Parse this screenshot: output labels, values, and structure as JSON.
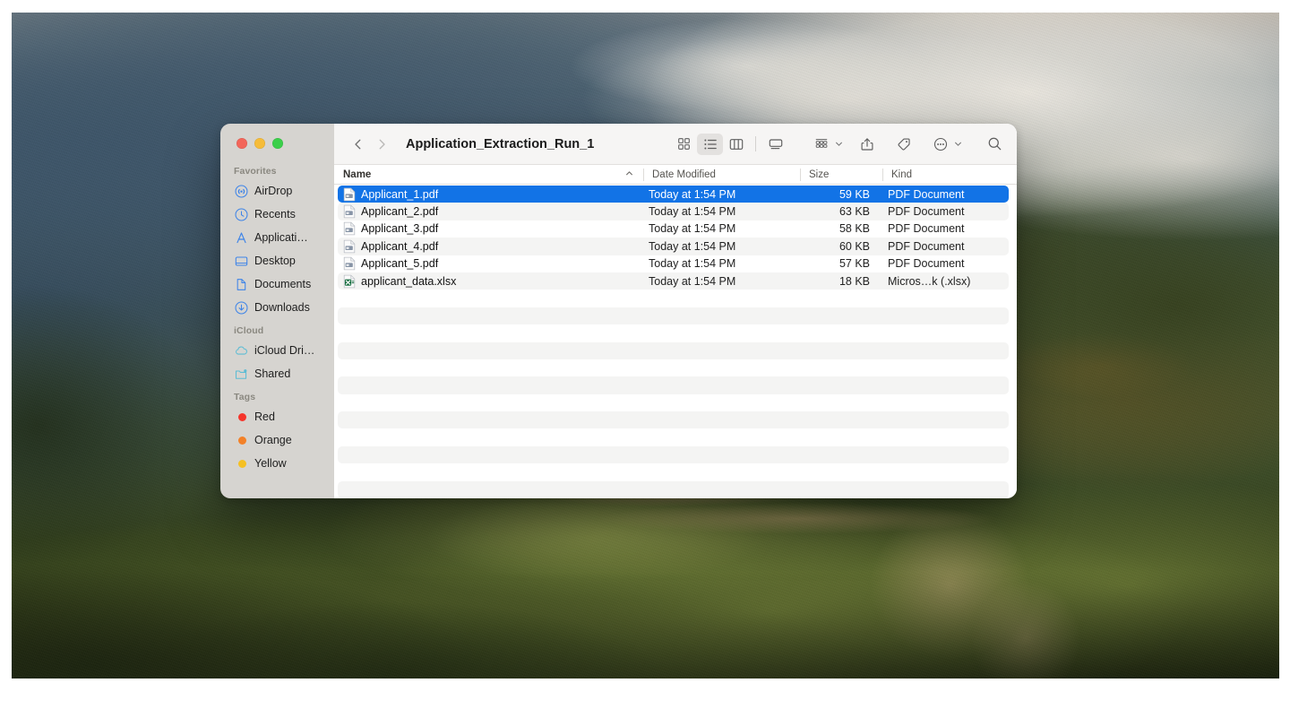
{
  "window": {
    "title": "Application_Extraction_Run_1",
    "traffic_lights": [
      "close",
      "minimize",
      "zoom"
    ]
  },
  "nav": {
    "back_icon": "chevron-left-icon",
    "forward_icon": "chevron-right-icon"
  },
  "toolbar": {
    "views": [
      {
        "name": "icon-view",
        "icon": "grid-icon",
        "active": false
      },
      {
        "name": "list-view",
        "icon": "list-icon",
        "active": true
      },
      {
        "name": "column-view",
        "icon": "columns-icon",
        "active": false
      },
      {
        "name": "gallery-view",
        "icon": "gallery-icon",
        "active": false
      }
    ],
    "actions": [
      {
        "name": "group-by",
        "icon": "group-icon",
        "chevron": true
      },
      {
        "name": "share",
        "icon": "share-icon",
        "chevron": false
      },
      {
        "name": "tag",
        "icon": "tag-icon",
        "chevron": false
      },
      {
        "name": "more-actions",
        "icon": "ellipsis-icon",
        "chevron": true
      },
      {
        "name": "search",
        "icon": "search-icon",
        "chevron": false
      }
    ]
  },
  "sidebar": {
    "sections": [
      {
        "heading": "Favorites",
        "items": [
          {
            "label": "AirDrop",
            "icon": "airdrop-icon"
          },
          {
            "label": "Recents",
            "icon": "clock-icon"
          },
          {
            "label": "Applicati…",
            "icon": "applications-icon"
          },
          {
            "label": "Desktop",
            "icon": "desktop-icon"
          },
          {
            "label": "Documents",
            "icon": "document-icon"
          },
          {
            "label": "Downloads",
            "icon": "download-icon"
          }
        ]
      },
      {
        "heading": "iCloud",
        "items": [
          {
            "label": "iCloud Dri…",
            "icon": "cloud-icon"
          },
          {
            "label": "Shared",
            "icon": "shared-folder-icon"
          }
        ]
      },
      {
        "heading": "Tags",
        "items": [
          {
            "label": "Red",
            "icon": "tag-dot-icon",
            "color": "#f5352b"
          },
          {
            "label": "Orange",
            "icon": "tag-dot-icon",
            "color": "#f38128"
          },
          {
            "label": "Yellow",
            "icon": "tag-dot-icon",
            "color": "#f5c022"
          }
        ]
      }
    ]
  },
  "file_list": {
    "columns": [
      {
        "key": "name",
        "label": "Name",
        "sorted": true,
        "sort_icon": "chevron-up-icon"
      },
      {
        "key": "date",
        "label": "Date Modified"
      },
      {
        "key": "size",
        "label": "Size"
      },
      {
        "key": "kind",
        "label": "Kind"
      }
    ],
    "rows": [
      {
        "name": "Applicant_1.pdf",
        "date": "Today at 1:54 PM",
        "size": "59 KB",
        "kind": "PDF Document",
        "icon": "pdf-file-icon",
        "selected": true,
        "striped": false
      },
      {
        "name": "Applicant_2.pdf",
        "date": "Today at 1:54 PM",
        "size": "63 KB",
        "kind": "PDF Document",
        "icon": "pdf-file-icon",
        "selected": false,
        "striped": true
      },
      {
        "name": "Applicant_3.pdf",
        "date": "Today at 1:54 PM",
        "size": "58 KB",
        "kind": "PDF Document",
        "icon": "pdf-file-icon",
        "selected": false,
        "striped": false
      },
      {
        "name": "Applicant_4.pdf",
        "date": "Today at 1:54 PM",
        "size": "60 KB",
        "kind": "PDF Document",
        "icon": "pdf-file-icon",
        "selected": false,
        "striped": true
      },
      {
        "name": "Applicant_5.pdf",
        "date": "Today at 1:54 PM",
        "size": "57 KB",
        "kind": "PDF Document",
        "icon": "pdf-file-icon",
        "selected": false,
        "striped": false
      },
      {
        "name": "applicant_data.xlsx",
        "date": "Today at 1:54 PM",
        "size": "18 KB",
        "kind": "Micros…k (.xlsx)",
        "icon": "xlsx-file-icon",
        "selected": false,
        "striped": true
      }
    ],
    "empty_row_count": 12
  },
  "colors": {
    "selection_blue": "#1273e6",
    "stripe_gray": "#f4f4f3",
    "sidebar_gray": "#d6d4d0",
    "toolbar_gray": "#f6f5f4"
  }
}
